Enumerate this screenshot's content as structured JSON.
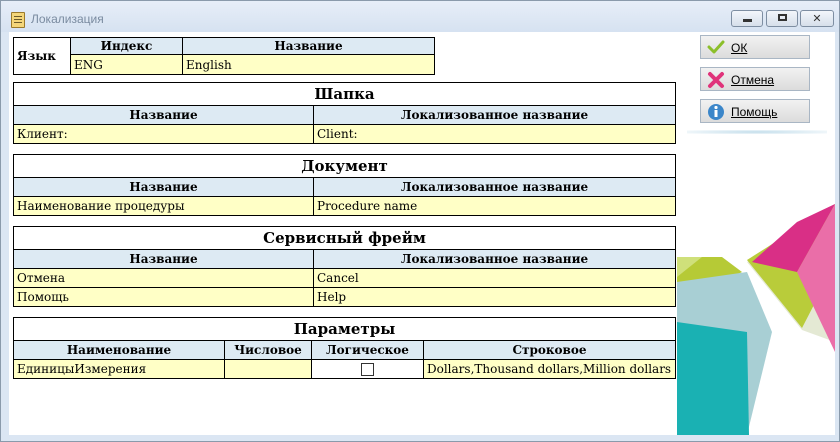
{
  "window": {
    "title": "Локализация",
    "min_glyph": "",
    "max_glyph": "",
    "close_glyph": "✕"
  },
  "language": {
    "label": "Язык",
    "index_header": "Индекс",
    "name_header": "Название",
    "index_value": "ENG",
    "name_value": "English"
  },
  "sections": {
    "header": {
      "title": "Шапка",
      "col1": "Название",
      "col2": "Локализованное название",
      "rows": [
        {
          "name": "Клиент:",
          "localized": "Client:"
        }
      ]
    },
    "document": {
      "title": "Документ",
      "col1": "Название",
      "col2": "Локализованное название",
      "rows": [
        {
          "name": "Наименование процедуры",
          "localized": "Procedure name"
        }
      ]
    },
    "service": {
      "title": "Сервисный фрейм",
      "col1": "Название",
      "col2": "Локализованное название",
      "rows": [
        {
          "name": "Отмена",
          "localized": "Cancel"
        },
        {
          "name": "Помощь",
          "localized": "Help"
        }
      ]
    },
    "params": {
      "title": "Параметры",
      "col1": "Наименование",
      "col2": "Числовое",
      "col3": "Логическое",
      "col4": "Строковое",
      "rows": [
        {
          "name": "ЕдиницыИзмерения",
          "numeric": "",
          "logical": false,
          "string": "Dollars,Thousand dollars,Million dollars"
        }
      ]
    }
  },
  "buttons": {
    "ok": "ОК",
    "cancel": "Отмена",
    "help": "Помощь"
  },
  "colors": {
    "header_bg": "#ddeaf3",
    "cell_bg": "#ffffc6",
    "window_frame": "#dbe6f3"
  }
}
